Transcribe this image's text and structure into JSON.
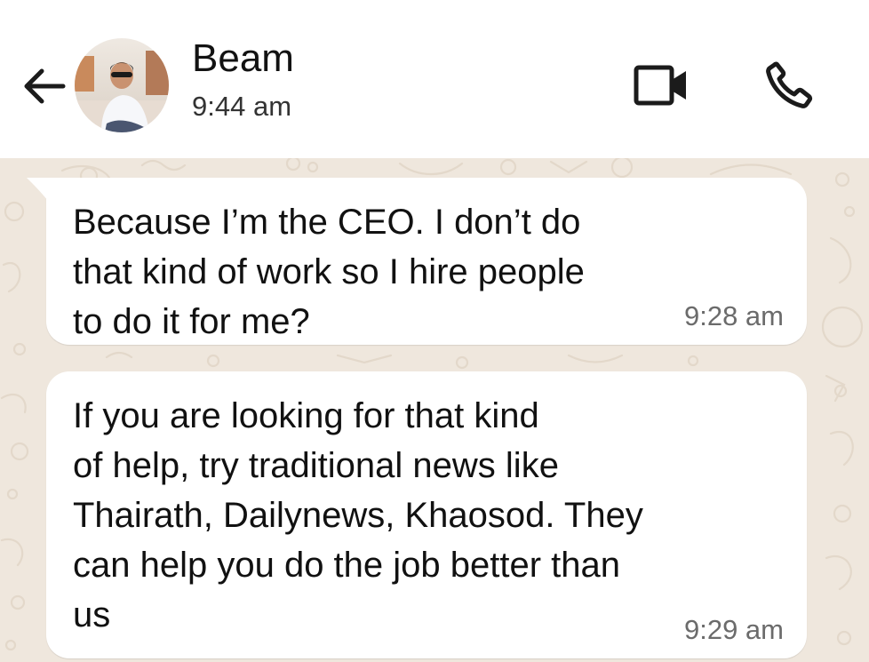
{
  "header": {
    "contact_name": "Beam",
    "last_seen": "9:44 am",
    "back_icon": "arrow-left-icon",
    "video_icon": "video-camera-icon",
    "call_icon": "phone-icon"
  },
  "messages": [
    {
      "text": "Because I’m the CEO. I don’t do\nthat kind of work so I hire people\nto do it for me?",
      "time": "9:28 am"
    },
    {
      "text": "If you are looking for that kind\nof help, try traditional news like\nThairath, Dailynews, Khaosod. They\ncan help you do the job better than\nus",
      "time": "9:29 am"
    }
  ],
  "colors": {
    "chat_background": "#efe7dd",
    "bubble": "#ffffff",
    "text": "#111111",
    "timestamp": "#6b6b6b"
  }
}
